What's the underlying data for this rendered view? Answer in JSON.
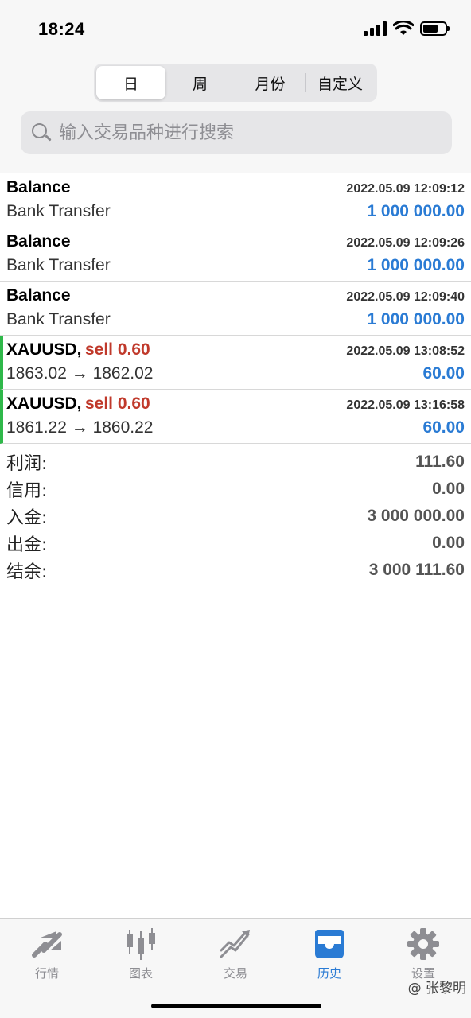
{
  "status_bar": {
    "time": "18:24"
  },
  "segment": {
    "items": [
      "日",
      "周",
      "月份",
      "自定义"
    ],
    "active_index": 0
  },
  "search": {
    "placeholder": "输入交易品种进行搜索"
  },
  "deals": [
    {
      "type": "balance",
      "title": "Balance",
      "time": "2022.05.09 12:09:12",
      "comment": "Bank Transfer",
      "amount": "1 000 000.00"
    },
    {
      "type": "balance",
      "title": "Balance",
      "time": "2022.05.09 12:09:26",
      "comment": "Bank Transfer",
      "amount": "1 000 000.00"
    },
    {
      "type": "balance",
      "title": "Balance",
      "time": "2022.05.09 12:09:40",
      "comment": "Bank Transfer",
      "amount": "1 000 000.00"
    },
    {
      "type": "trade",
      "title": "XAUUSD,",
      "side": "sell 0.60",
      "time": "2022.05.09 13:08:52",
      "comment": "1863.02 → 1862.02",
      "amount": "60.00"
    },
    {
      "type": "trade",
      "title": "XAUUSD,",
      "side": "sell 0.60",
      "time": "2022.05.09 13:16:58",
      "comment": "1861.22 → 1860.22",
      "amount": "60.00"
    }
  ],
  "summary": [
    {
      "label": "利润:",
      "value": "111.60"
    },
    {
      "label": "信用:",
      "value": "0.00"
    },
    {
      "label": "入金:",
      "value": "3 000 000.00"
    },
    {
      "label": "出金:",
      "value": "0.00"
    },
    {
      "label": "结余:",
      "value": "3 000 111.60"
    }
  ],
  "tabbar": {
    "items": [
      {
        "label": "行情",
        "icon": "quotes-arrows-icon"
      },
      {
        "label": "图表",
        "icon": "candlestick-chart-icon"
      },
      {
        "label": "交易",
        "icon": "trade-trend-icon"
      },
      {
        "label": "历史",
        "icon": "history-inbox-icon"
      },
      {
        "label": "设置",
        "icon": "gear-icon"
      }
    ],
    "active_index": 3
  },
  "watermark": "@ 张黎明",
  "colors": {
    "accent": "#2a7bd4",
    "sell": "#c0392b",
    "trade_marker": "#2fb84a",
    "icon_gray": "#8e8e93"
  }
}
